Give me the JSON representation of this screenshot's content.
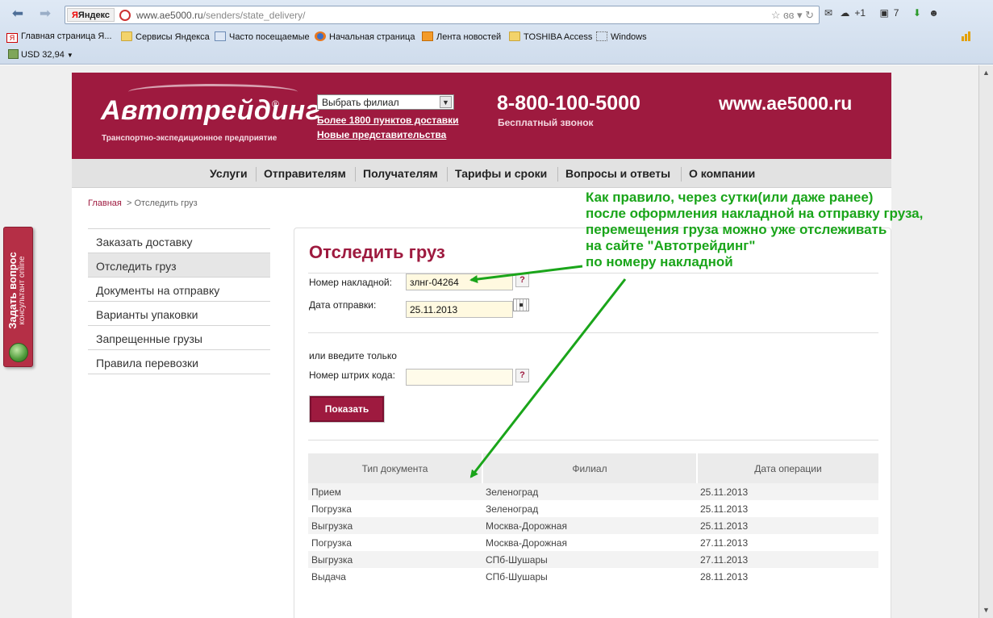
{
  "browser": {
    "search_engine": "Яндекс",
    "url_domain": "www.ae5000.ru",
    "url_path": "/senders/state_delivery/",
    "tools": {
      "weather": "+1",
      "notifications": "7"
    },
    "bookmarks": [
      {
        "label": "Главная страница Я...",
        "icon": "yandex-icon"
      },
      {
        "label": "Сервисы Яндекса",
        "icon": "folder-icon"
      },
      {
        "label": "Часто посещаемые",
        "icon": "star-page-icon"
      },
      {
        "label": "Начальная страница",
        "icon": "firefox-icon"
      },
      {
        "label": "Лента новостей",
        "icon": "rss-icon"
      },
      {
        "label": "TOSHIBA Access",
        "icon": "folder-icon"
      },
      {
        "label": "Windows",
        "icon": "folder-icon"
      }
    ],
    "currency": "USD 32,94"
  },
  "header": {
    "logo": "Автотрейдинг",
    "logo_reg": "®",
    "logo_subtitle": "Транспортно-экспедиционное предприятие",
    "branch_select": "Выбрать филиал",
    "link_points": "Более 1800 пунктов доставки",
    "link_new": "Новые представительства",
    "phone": "8-800-100-5000",
    "phone_subtitle": "Бесплатный звонок",
    "site_url": "www.ae5000.ru"
  },
  "menu": [
    "Услуги",
    "Отправителям",
    "Получателям",
    "Тарифы и сроки",
    "Вопросы и ответы",
    "О компании"
  ],
  "breadcrumb": {
    "home": "Главная",
    "current": "> Отследить груз"
  },
  "sidebar": [
    {
      "label": "Заказать доставку"
    },
    {
      "label": "Отследить груз",
      "active": true
    },
    {
      "label": "Документы на отправку"
    },
    {
      "label": "Варианты упаковки"
    },
    {
      "label": "Запрещенные грузы"
    },
    {
      "label": "Правила перевозки"
    }
  ],
  "form": {
    "title": "Отследить груз",
    "waybill_label": "Номер накладной:",
    "waybill_value": "злнг-04264",
    "date_label": "Дата отправки:",
    "date_value": "25.11.2013",
    "or_text": "или введите только",
    "barcode_label": "Номер штрих кода:",
    "barcode_value": "",
    "help": "?",
    "submit": "Показать"
  },
  "results": {
    "headers": [
      "Тип документа",
      "Филиал",
      "Дата операции"
    ],
    "rows": [
      [
        "Прием",
        "Зеленоград",
        "25.11.2013"
      ],
      [
        "Погрузка",
        "Зеленоград",
        "25.11.2013"
      ],
      [
        "Выгрузка",
        "Москва-Дорожная",
        "25.11.2013"
      ],
      [
        "Погрузка",
        "Москва-Дорожная",
        "27.11.2013"
      ],
      [
        "Выгрузка",
        "СПб-Шушары",
        "27.11.2013"
      ],
      [
        "Выдача",
        "СПб-Шушары",
        "28.11.2013"
      ]
    ]
  },
  "ask_tab": {
    "title": "Задать вопрос",
    "subtitle": "консультант online"
  },
  "annotation": [
    "Как правило, через сутки(или даже ранее)",
    "после оформления накладной на отправку груза,",
    "перемещения груза можно уже отслеживать",
    "на сайте \"Автотрейдинг\"",
    "по номеру накладной"
  ],
  "colors": {
    "brand": "#9e1a3f",
    "annotation": "#1aa51a"
  }
}
